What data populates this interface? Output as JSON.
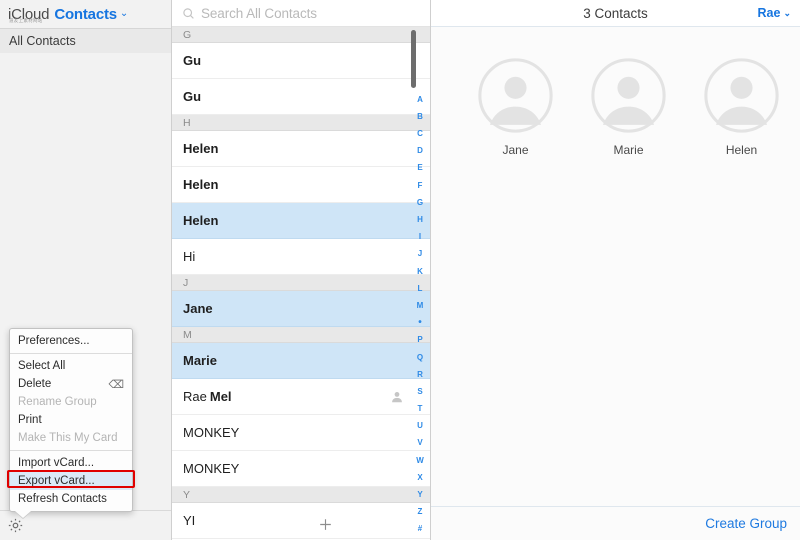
{
  "sidebar": {
    "brand_primary": "iCloud",
    "brand_app": "Contacts",
    "brand_caret": "⌄",
    "watermark": "道友上素材网站",
    "group_all": "All Contacts",
    "gear_icon": "gear-icon",
    "plus_icon": "plus-icon"
  },
  "context_menu": {
    "items": [
      {
        "label": "Preferences...",
        "disabled": false,
        "selected": false,
        "shortcut": "",
        "divider_after": true
      },
      {
        "label": "Select All",
        "disabled": false,
        "selected": false,
        "shortcut": "",
        "divider_after": false
      },
      {
        "label": "Delete",
        "disabled": false,
        "selected": false,
        "shortcut": "⌫",
        "divider_after": false
      },
      {
        "label": "Rename Group",
        "disabled": true,
        "selected": false,
        "shortcut": "",
        "divider_after": false
      },
      {
        "label": "Print",
        "disabled": false,
        "selected": false,
        "shortcut": "",
        "divider_after": false
      },
      {
        "label": "Make This My Card",
        "disabled": true,
        "selected": false,
        "shortcut": "",
        "divider_after": true
      },
      {
        "label": "Import vCard...",
        "disabled": false,
        "selected": false,
        "shortcut": "",
        "divider_after": false
      },
      {
        "label": "Export vCard...",
        "disabled": false,
        "selected": true,
        "shortcut": "",
        "divider_after": false
      },
      {
        "label": "Refresh Contacts",
        "disabled": false,
        "selected": false,
        "shortcut": "",
        "divider_after": false
      }
    ],
    "highlight_color": "#e00000",
    "selected_bg": "#dce9f7"
  },
  "search": {
    "placeholder": "Search All Contacts",
    "value": "",
    "icon": "search-icon"
  },
  "contact_list": {
    "rows": [
      {
        "type": "section",
        "label": "G"
      },
      {
        "type": "contact",
        "first": "Gu",
        "last": "",
        "bold": true,
        "selected": false,
        "mycard": false
      },
      {
        "type": "contact",
        "first": "Gu",
        "last": "",
        "bold": true,
        "selected": false,
        "mycard": false
      },
      {
        "type": "section",
        "label": "H"
      },
      {
        "type": "contact",
        "first": "Helen",
        "last": "",
        "bold": true,
        "selected": false,
        "mycard": false
      },
      {
        "type": "contact",
        "first": "Helen",
        "last": "",
        "bold": true,
        "selected": false,
        "mycard": false
      },
      {
        "type": "contact",
        "first": "Helen",
        "last": "",
        "bold": true,
        "selected": true,
        "mycard": false
      },
      {
        "type": "contact",
        "first": "Hi",
        "last": "",
        "bold": false,
        "selected": false,
        "mycard": false
      },
      {
        "type": "section",
        "label": "J"
      },
      {
        "type": "contact",
        "first": "Jane",
        "last": "",
        "bold": true,
        "selected": true,
        "mycard": false
      },
      {
        "type": "section",
        "label": "M"
      },
      {
        "type": "contact",
        "first": "Marie",
        "last": "",
        "bold": true,
        "selected": true,
        "mycard": false
      },
      {
        "type": "contact",
        "first": "Rae",
        "last": "Mel",
        "bold": false,
        "selected": false,
        "mycard": true
      },
      {
        "type": "contact",
        "first": "MONKEY",
        "last": "",
        "bold": false,
        "selected": false,
        "mycard": false
      },
      {
        "type": "contact",
        "first": "MONKEY",
        "last": "",
        "bold": false,
        "selected": false,
        "mycard": false
      },
      {
        "type": "section",
        "label": "Y"
      },
      {
        "type": "contact",
        "first": "YI",
        "last": "",
        "bold": false,
        "selected": false,
        "mycard": false
      }
    ],
    "alphabet_index": [
      "A",
      "B",
      "C",
      "D",
      "E",
      "F",
      "G",
      "H",
      "I",
      "J",
      "K",
      "L",
      "M",
      "•",
      "P",
      "Q",
      "R",
      "S",
      "T",
      "U",
      "V",
      "W",
      "X",
      "Y",
      "Z",
      "#"
    ],
    "index_color": "#2e8ae6",
    "selected_row_color": "#cfe5f7"
  },
  "detail": {
    "title": "3 Contacts",
    "account_label": "Rae",
    "account_caret": "⌄",
    "cards": [
      {
        "name": "Jane",
        "avatar": "person-avatar-icon"
      },
      {
        "name": "Marie",
        "avatar": "person-avatar-icon"
      },
      {
        "name": "Helen",
        "avatar": "person-avatar-icon"
      }
    ],
    "create_group_label": "Create Group"
  },
  "colors": {
    "accent_blue": "#1675e0",
    "link_blue": "#1f7ae0",
    "index_blue": "#2e8ae6",
    "selection_blue": "#cfe5f7",
    "annotation_red": "#e00000",
    "sidebar_bg": "#f2f2f2"
  }
}
